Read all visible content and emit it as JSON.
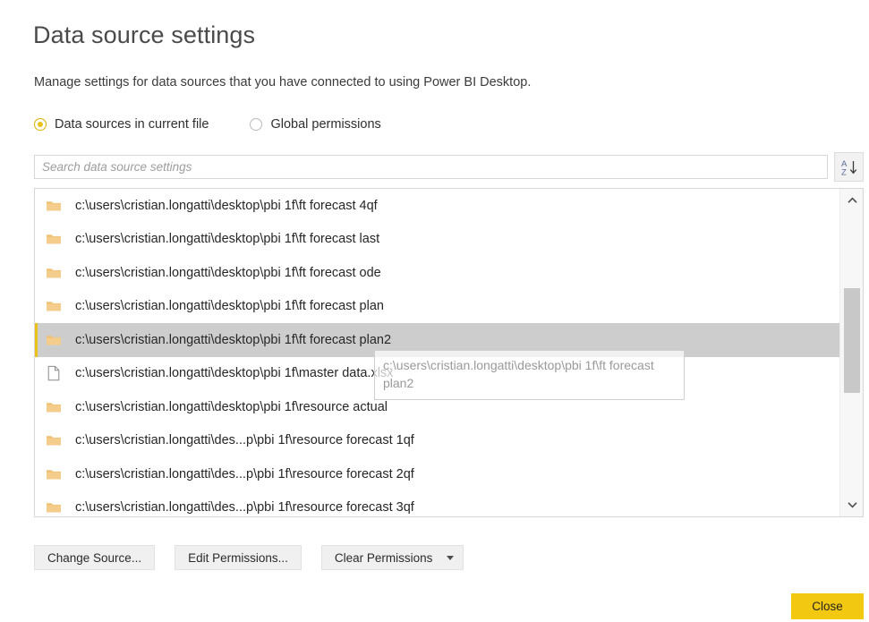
{
  "dialog": {
    "title": "Data source settings",
    "description": "Manage settings for data sources that you have connected to using Power BI Desktop."
  },
  "scope": {
    "options": [
      {
        "label": "Data sources in current file",
        "selected": true
      },
      {
        "label": "Global permissions",
        "selected": false
      }
    ]
  },
  "search": {
    "placeholder": "Search data source settings",
    "value": ""
  },
  "sort": {
    "icon": "sort-az-descending-icon",
    "letter_top": "A",
    "letter_bottom": "Z"
  },
  "list": {
    "items": [
      {
        "icon": "folder-icon",
        "label": "c:\\users\\cristian.longatti\\desktop\\pbi 1f\\ft forecast 4qf",
        "selected": false
      },
      {
        "icon": "folder-icon",
        "label": "c:\\users\\cristian.longatti\\desktop\\pbi 1f\\ft forecast last",
        "selected": false
      },
      {
        "icon": "folder-icon",
        "label": "c:\\users\\cristian.longatti\\desktop\\pbi 1f\\ft forecast ode",
        "selected": false
      },
      {
        "icon": "folder-icon",
        "label": "c:\\users\\cristian.longatti\\desktop\\pbi 1f\\ft forecast plan",
        "selected": false
      },
      {
        "icon": "folder-icon",
        "label": "c:\\users\\cristian.longatti\\desktop\\pbi 1f\\ft forecast plan2",
        "selected": true
      },
      {
        "icon": "file-icon",
        "label": "c:\\users\\cristian.longatti\\desktop\\pbi 1f\\master data.xlsx",
        "selected": false
      },
      {
        "icon": "folder-icon",
        "label": "c:\\users\\cristian.longatti\\desktop\\pbi 1f\\resource actual",
        "selected": false
      },
      {
        "icon": "folder-icon",
        "label": "c:\\users\\cristian.longatti\\des...p\\pbi 1f\\resource forecast 1qf",
        "selected": false
      },
      {
        "icon": "folder-icon",
        "label": "c:\\users\\cristian.longatti\\des...p\\pbi 1f\\resource forecast 2qf",
        "selected": false
      },
      {
        "icon": "folder-icon",
        "label": "c:\\users\\cristian.longatti\\des...p\\pbi 1f\\resource forecast 3qf",
        "selected": false
      }
    ]
  },
  "tooltip": {
    "text": "c:\\users\\cristian.longatti\\desktop\\pbi 1f\\ft forecast plan2"
  },
  "actions": {
    "change_source": "Change Source...",
    "edit_permissions": "Edit Permissions...",
    "clear_permissions": "Clear Permissions",
    "close": "Close"
  },
  "colors": {
    "accent": "#f2c811",
    "folder": "#f0c073",
    "selected_row": "#cdcdcd"
  }
}
